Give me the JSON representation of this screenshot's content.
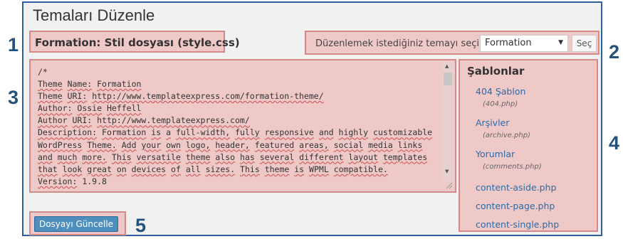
{
  "page_title": "Temaları Düzenle",
  "file_title": "Formation: Stil dosyası (style.css)",
  "theme_picker": {
    "label": "Düzenlemek istediğiniz temayı seçin:",
    "selected": "Formation",
    "button": "Seç"
  },
  "editor": {
    "lines": [
      "/*",
      "Theme Name: Formation",
      "Theme URI: http://www.templateexpress.com/formation-theme/",
      "Author: Ossie Heffell",
      "Author URI: http://www.templateexpress.com/",
      "Description: Formation is a full-width, fully responsive and highly customizable",
      "WordPress Theme. Add your own logo, header, featured areas, social media links",
      "and much more. This versatile theme also has several different layout templates",
      "that look great on devices of all sizes. This theme is WPML compatible.",
      "Version: 1.9.8"
    ]
  },
  "templates": {
    "heading": "Şablonlar",
    "items": [
      {
        "name": "404 Şablon",
        "file": "(404.php)"
      },
      {
        "name": "Arşivler",
        "file": "(archive.php)"
      },
      {
        "name": "Yorumlar",
        "file": "(comments.php)"
      },
      {
        "name": "content-aside.php",
        "file": ""
      },
      {
        "name": "content-page.php",
        "file": ""
      },
      {
        "name": "content-single.php",
        "file": ""
      }
    ]
  },
  "update_button": "Dosyayı Güncelle",
  "markers": [
    "1",
    "2",
    "3",
    "4",
    "5"
  ],
  "colors": {
    "frame_border": "#2e5f9e",
    "highlight_fill": "#efc8c8",
    "highlight_border": "#d58a8a",
    "marker": "#23527c",
    "link": "#2a6ca8",
    "button": "#4f8fbe"
  }
}
